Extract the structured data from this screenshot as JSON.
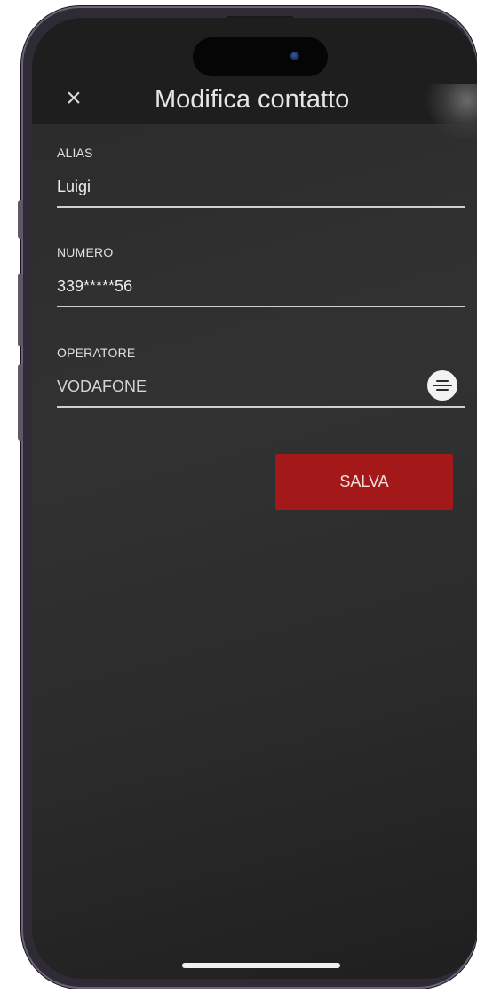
{
  "header": {
    "title": "Modifica contatto",
    "close_icon": "×"
  },
  "form": {
    "alias": {
      "label": "ALIAS",
      "value": "Luigi"
    },
    "numero": {
      "label": "NUMERO",
      "value": "339*****56"
    },
    "operatore": {
      "label": "OPERATORE",
      "value": "VODAFONE",
      "menu_icon": "list-menu-icon"
    }
  },
  "actions": {
    "save_label": "SALVA"
  },
  "colors": {
    "accent": "#a3191a",
    "background": "#2a2a2a",
    "header_bg": "#1e1e1e"
  }
}
